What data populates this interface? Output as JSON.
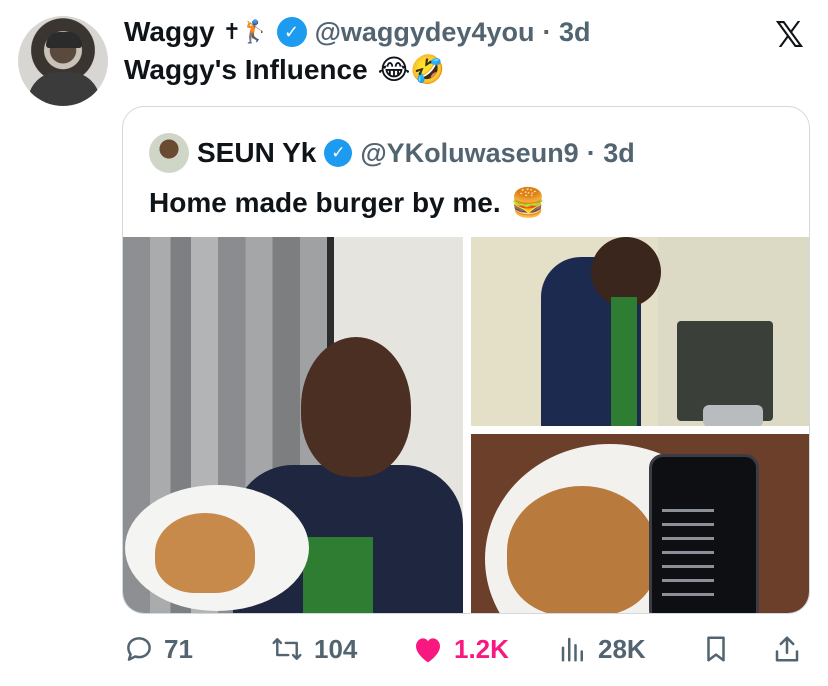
{
  "tweet": {
    "author_name": "Waggy",
    "author_name_icons": "✝🏌️",
    "handle": "@waggydey4you",
    "time": "· 3d",
    "text": "Waggy's Influence",
    "text_emojis": "😂🤣"
  },
  "quote": {
    "author_name": "SEUN Yk",
    "handle": "@YKoluwaseun9",
    "time": "· 3d",
    "text": "Home made burger by me.",
    "text_emoji": "🍔"
  },
  "actions": {
    "replies": "71",
    "reposts": "104",
    "likes": "1.2K",
    "views": "28K"
  },
  "icons": {
    "brand": "x-logo-icon",
    "verified": "verified-badge-icon",
    "reply": "reply-icon",
    "repost": "repost-icon",
    "like": "heart-icon",
    "views": "views-chart-icon",
    "bookmark": "bookmark-icon",
    "share": "share-icon"
  },
  "colors": {
    "accent_blue": "#1d9bf0",
    "like_pink": "#f91880",
    "muted_text": "#536471",
    "text": "#0f1419",
    "border": "#cfd9de"
  }
}
